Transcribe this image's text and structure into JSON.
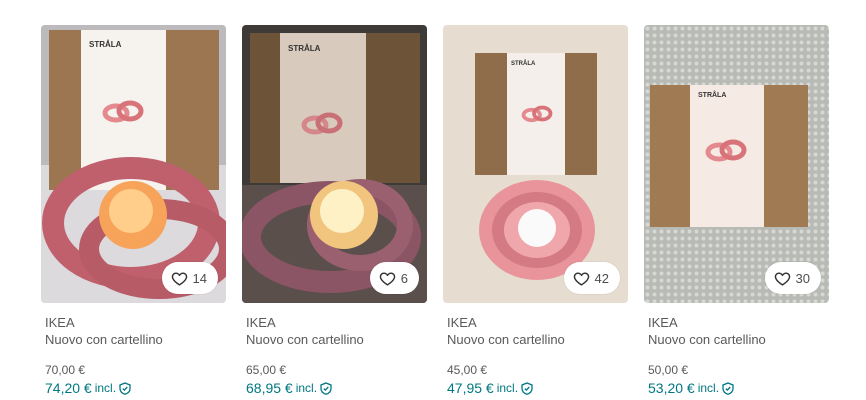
{
  "items": [
    {
      "brand": "IKEA",
      "status": "Nuovo con cartellino",
      "price": "70,00 €",
      "price_incl": "74,20 €",
      "incl_label": "incl.",
      "favorites": "14",
      "box_label": "STRÅLA"
    },
    {
      "brand": "IKEA",
      "status": "Nuovo con cartellino",
      "price": "65,00 €",
      "price_incl": "68,95 €",
      "incl_label": "incl.",
      "favorites": "6",
      "box_label": "STRÅLA"
    },
    {
      "brand": "IKEA",
      "status": "Nuovo con cartellino",
      "price": "45,00 €",
      "price_incl": "47,95 €",
      "incl_label": "incl.",
      "favorites": "42",
      "box_label": "STRÅLA"
    },
    {
      "brand": "IKEA",
      "status": "Nuovo con cartellino",
      "price": "50,00 €",
      "price_incl": "53,20 €",
      "incl_label": "incl.",
      "favorites": "30",
      "box_label": "STRÅLA"
    }
  ],
  "icons": {
    "favorite": "heart-outline-icon",
    "buyer_protection": "shield-check-icon"
  },
  "colors": {
    "accent": "#007782",
    "secondary_text": "#595959"
  }
}
